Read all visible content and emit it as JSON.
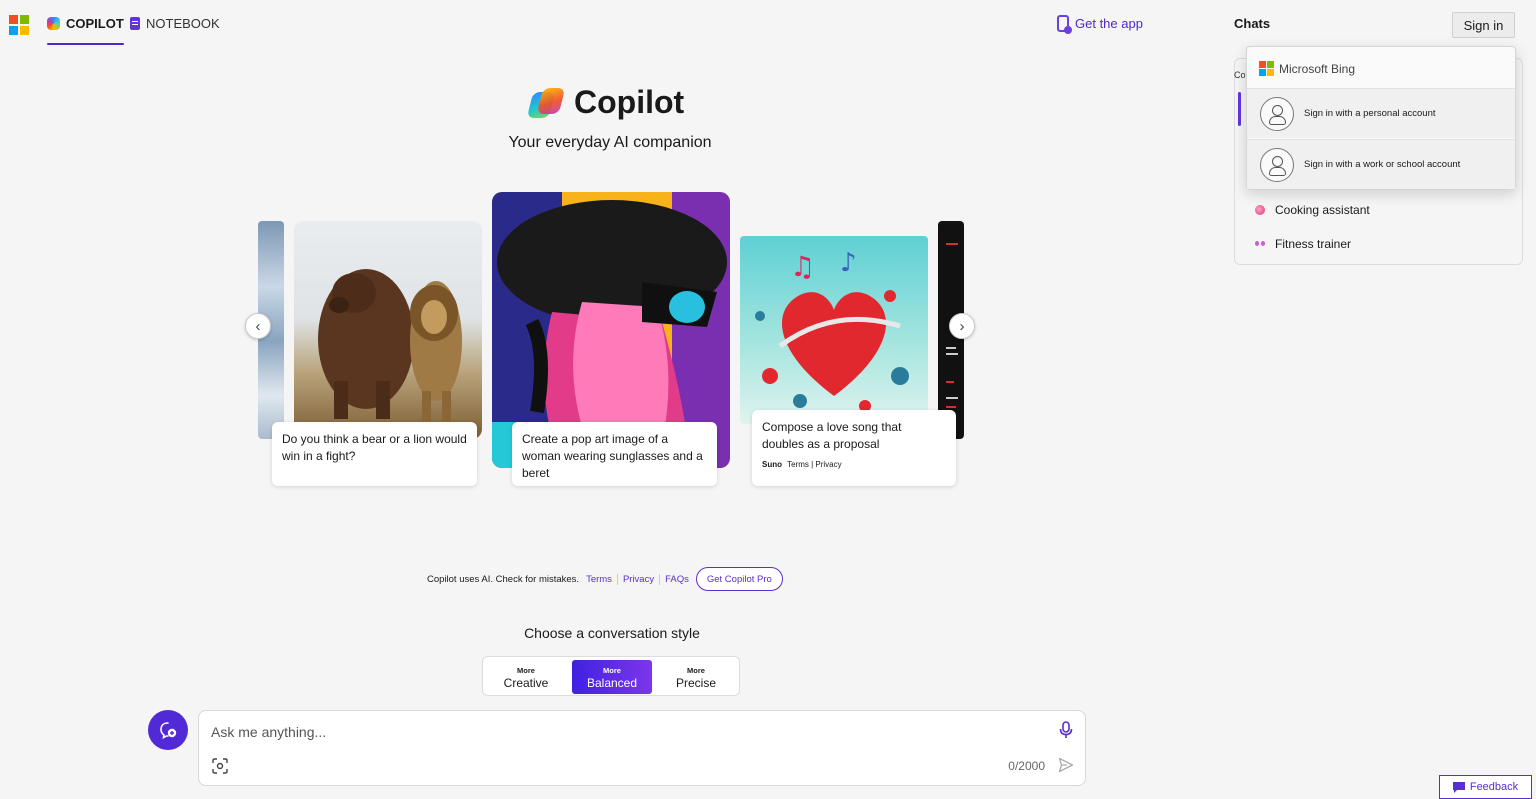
{
  "nav": {
    "copilot_label": "COPILOT",
    "notebook_label": "NOTEBOOK",
    "get_app_label": "Get the app"
  },
  "chats": {
    "title": "Chats",
    "sign_in_label": "Sign in",
    "section_label": "Co",
    "items": [
      {
        "label": "Cooking assistant",
        "icon": "cooking-icon"
      },
      {
        "label": "Fitness trainer",
        "icon": "fitness-icon"
      }
    ]
  },
  "signin_popup": {
    "brand": "Microsoft Bing",
    "options": [
      {
        "label": "Sign in with a personal account"
      },
      {
        "label": "Sign in with a work or school account"
      }
    ]
  },
  "hero": {
    "title": "Copilot",
    "subtitle": "Your everyday AI companion"
  },
  "carousel": {
    "cards": [
      {
        "caption": "Do you think a bear or a lion would win in a fight?"
      },
      {
        "caption": "Create a pop art image of a woman wearing sunglasses and a beret"
      },
      {
        "caption": "Compose a love song that doubles as a proposal",
        "brand": "Suno",
        "terms": "Terms",
        "privacy": "Privacy"
      }
    ],
    "prev_icon": "chevron-left-icon",
    "next_icon": "chevron-right-icon"
  },
  "legal": {
    "notice": "Copilot uses AI. Check for mistakes.",
    "terms": "Terms",
    "privacy": "Privacy",
    "faqs": "FAQs",
    "pro_button": "Get Copilot Pro"
  },
  "conversation_style": {
    "title": "Choose a conversation style",
    "options": [
      {
        "top": "More",
        "label": "Creative"
      },
      {
        "top": "More",
        "label": "Balanced",
        "selected": true
      },
      {
        "top": "More",
        "label": "Precise"
      }
    ]
  },
  "input": {
    "placeholder": "Ask me anything...",
    "counter": "0/2000"
  },
  "feedback": {
    "label": "Feedback"
  },
  "colors": {
    "accent": "#5129d6",
    "link": "#5b2ed0",
    "background": "#f5f5f5"
  }
}
